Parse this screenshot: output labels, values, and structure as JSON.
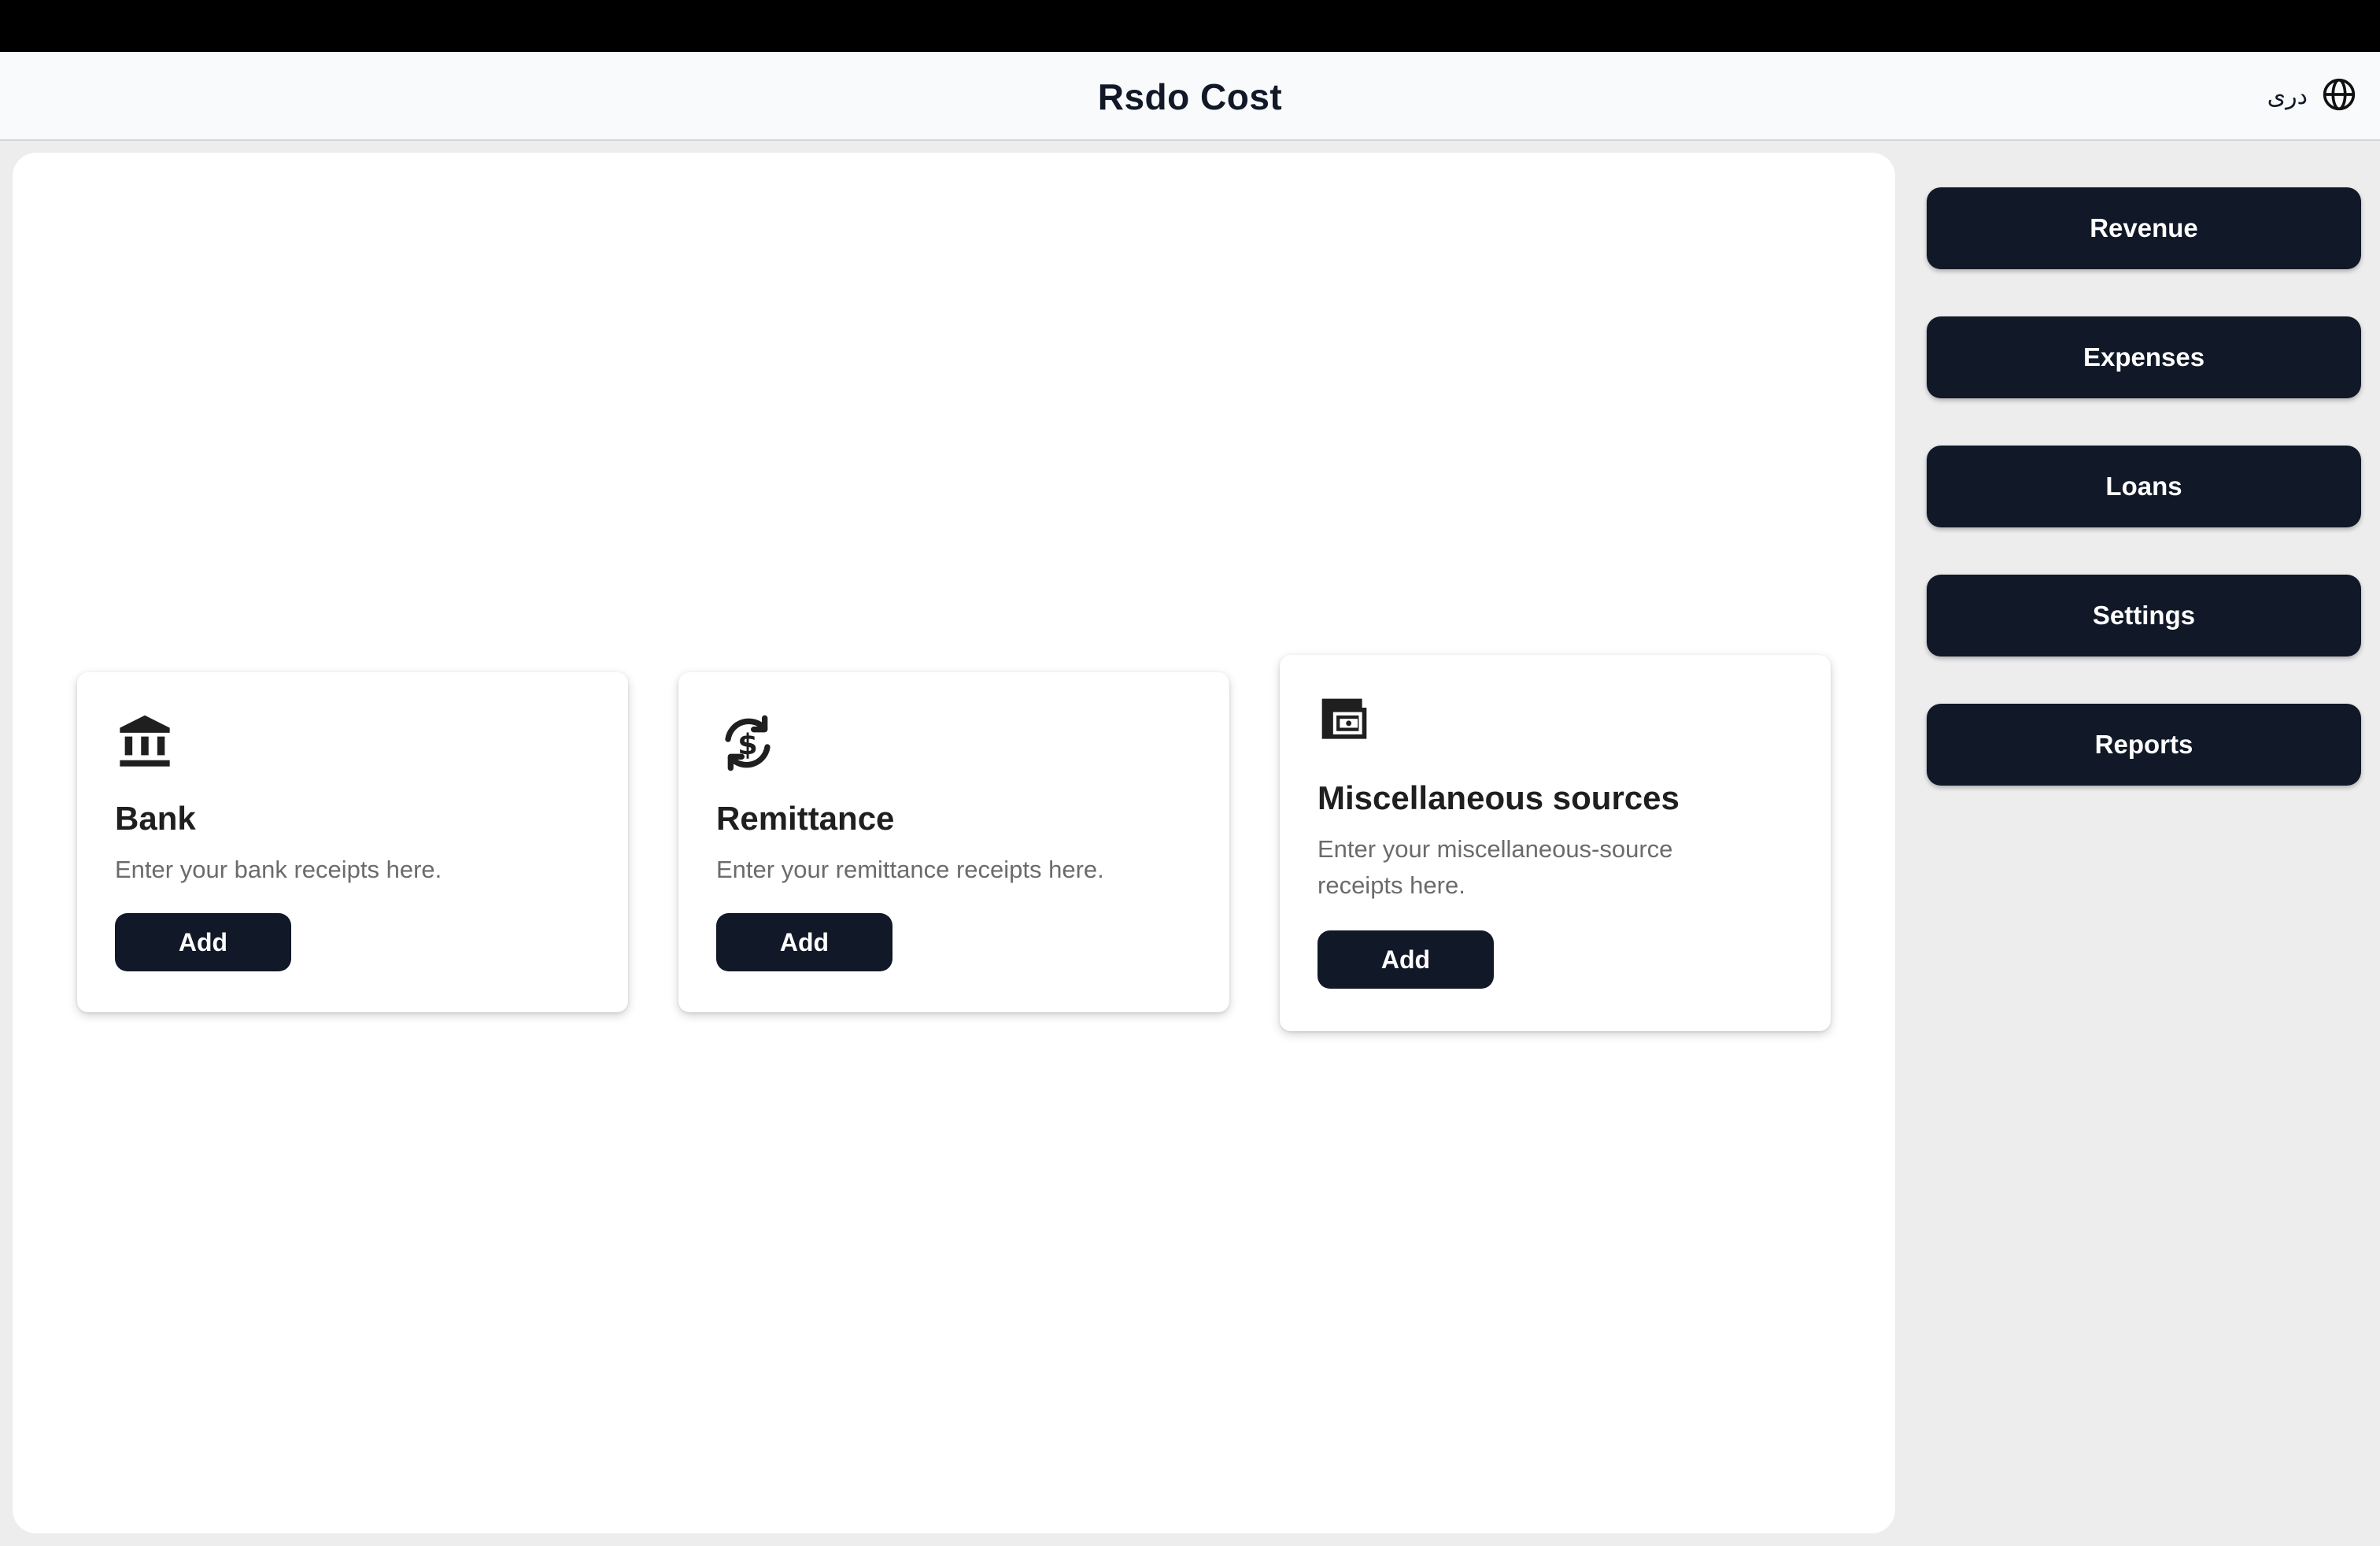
{
  "header": {
    "title": "Rsdo Cost",
    "language_label": "دری",
    "language_icon": "globe-icon"
  },
  "cards": [
    {
      "icon": "bank-icon",
      "title": "Bank",
      "description": "Enter your bank receipts here.",
      "button": "Add"
    },
    {
      "icon": "currency-exchange-icon",
      "title": "Remittance",
      "description": "Enter your remittance receipts here.",
      "button": "Add"
    },
    {
      "icon": "wallet-icon",
      "title": "Miscellaneous sources",
      "description": "Enter your miscellaneous-source receipts here.",
      "button": "Add"
    }
  ],
  "sidebar": {
    "items": [
      {
        "label": "Revenue"
      },
      {
        "label": "Expenses"
      },
      {
        "label": "Loans"
      },
      {
        "label": "Settings"
      },
      {
        "label": "Reports"
      }
    ]
  },
  "colors": {
    "primary_button": "#111827",
    "header_background": "#f9fafb",
    "page_background": "#ededed"
  }
}
